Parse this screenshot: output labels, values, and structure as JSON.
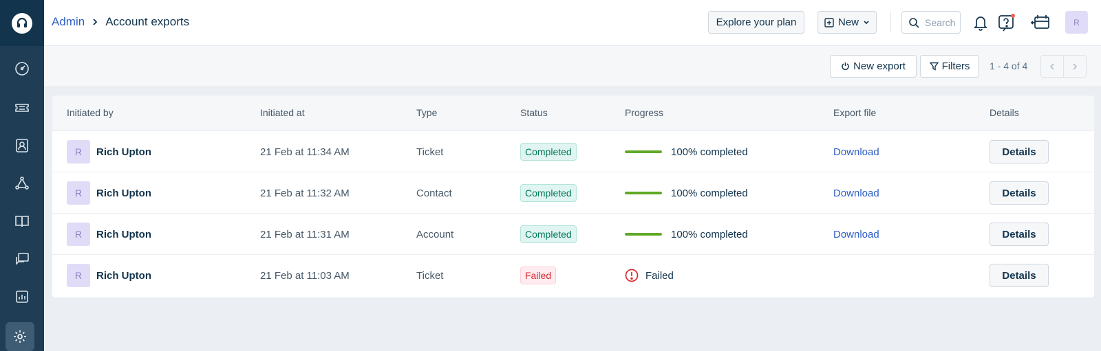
{
  "breadcrumb": {
    "parent": "Admin",
    "current": "Account exports"
  },
  "header": {
    "explore_label": "Explore your plan",
    "new_label": "New",
    "search_placeholder": "Search",
    "avatar_initial": "R"
  },
  "toolbar": {
    "new_export_label": "New export",
    "filters_label": "Filters",
    "page_info": "1 - 4 of 4"
  },
  "table": {
    "columns": [
      "Initiated by",
      "Initiated at",
      "Type",
      "Status",
      "Progress",
      "Export file",
      "Details"
    ],
    "rows": [
      {
        "initial": "R",
        "name": "Rich Upton",
        "initiated_at": "21 Feb at 11:34 AM",
        "type": "Ticket",
        "status": "Completed",
        "progress": 1.0,
        "progress_text": "100% completed",
        "file": "Download",
        "details": "Details"
      },
      {
        "initial": "R",
        "name": "Rich Upton",
        "initiated_at": "21 Feb at 11:32 AM",
        "type": "Contact",
        "status": "Completed",
        "progress": 1.0,
        "progress_text": "100% completed",
        "file": "Download",
        "details": "Details"
      },
      {
        "initial": "R",
        "name": "Rich Upton",
        "initiated_at": "21 Feb at 11:31 AM",
        "type": "Account",
        "status": "Completed",
        "progress": 1.0,
        "progress_text": "100% completed",
        "file": "Download",
        "details": "Details"
      },
      {
        "initial": "R",
        "name": "Rich Upton",
        "initiated_at": "21 Feb at 11:03 AM",
        "type": "Ticket",
        "status": "Failed",
        "progress_text": "Failed",
        "details": "Details"
      }
    ]
  },
  "sidebar": {
    "items": [
      "dashboard-icon",
      "ticket-icon",
      "contact-icon",
      "network-icon",
      "book-icon",
      "chat-icon",
      "report-icon",
      "gear-icon"
    ],
    "active": "gear-icon"
  },
  "colors": {
    "accent": "#2c5cc5",
    "sidebar": "#1f3d55",
    "success": "#5fa927",
    "danger": "#d72d30"
  }
}
